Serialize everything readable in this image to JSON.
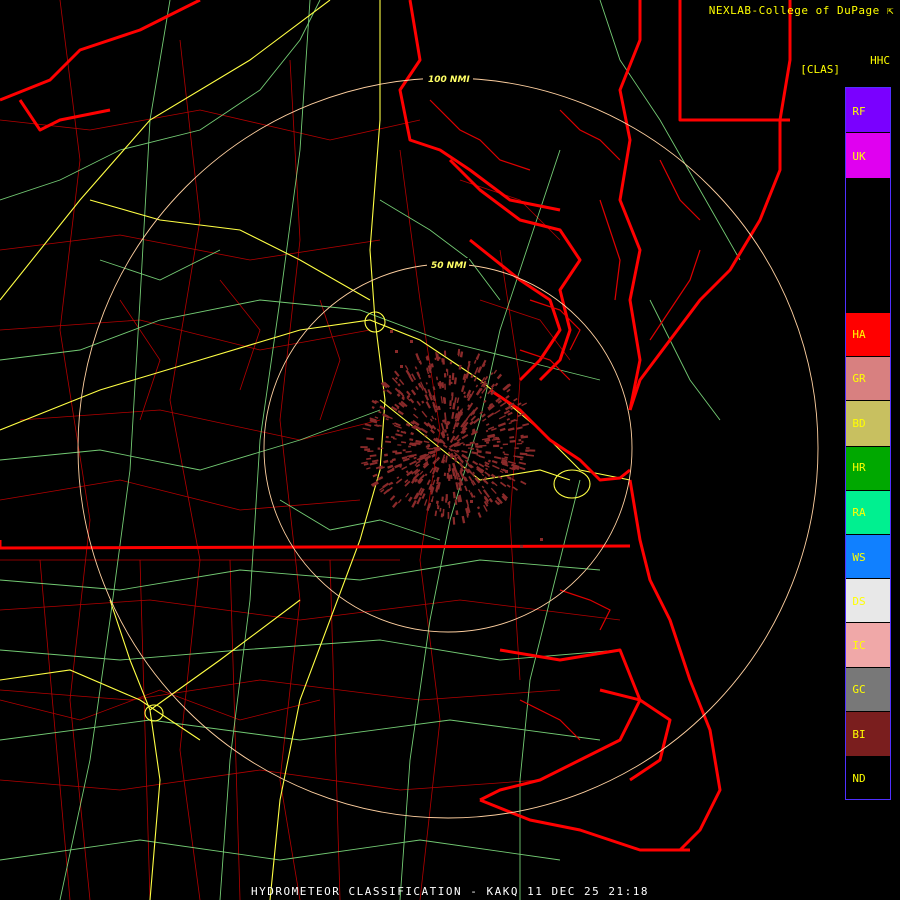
{
  "credit": "NEXLAB-College of DuPage",
  "product_code": "HHC",
  "product_bracket": "[CLAS]",
  "footer_title": "HYDROMETEOR CLASSIFICATION - KAKQ 11 DEC 25 21:18",
  "range_rings": [
    {
      "label": "50 NMI"
    },
    {
      "label": "100 NMI"
    }
  ],
  "colors": {
    "state_border": "#ff0000",
    "county_line": "#c80000",
    "highway": "#ffff44",
    "road": "#88ee88",
    "ring": "#ffd0a0",
    "echo": "#8a2a2a"
  },
  "legend": [
    {
      "code": "RF",
      "color": "#7a00ff"
    },
    {
      "code": "UK",
      "color": "#e000f0"
    },
    {
      "code": "HA",
      "color": "#ff0000"
    },
    {
      "code": "GR",
      "color": "#d88080"
    },
    {
      "code": "BD",
      "color": "#c8c060"
    },
    {
      "code": "HR",
      "color": "#00a800"
    },
    {
      "code": "RA",
      "color": "#00f090"
    },
    {
      "code": "WS",
      "color": "#1080ff"
    },
    {
      "code": "DS",
      "color": "#e8e8e8"
    },
    {
      "code": "IC",
      "color": "#f0a8a8"
    },
    {
      "code": "GC",
      "color": "#787878"
    },
    {
      "code": "BI",
      "color": "#7a1e1e"
    },
    {
      "code": "ND",
      "color": "#000000"
    }
  ]
}
